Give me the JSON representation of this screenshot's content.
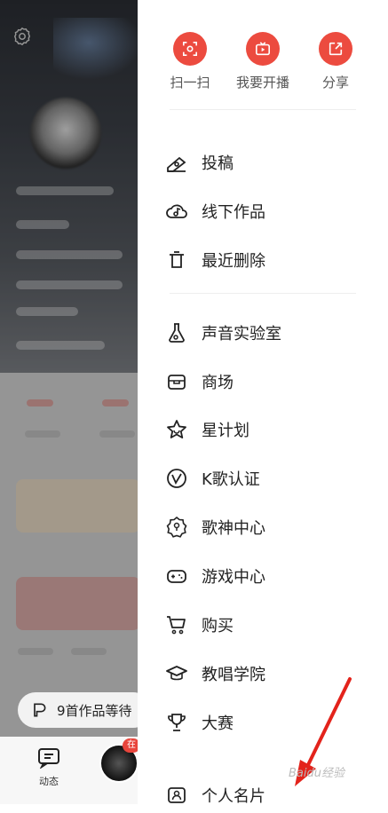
{
  "quick_actions": [
    {
      "label": "扫一扫",
      "icon": "scan-icon"
    },
    {
      "label": "我要开播",
      "icon": "live-tv-icon"
    },
    {
      "label": "分享",
      "icon": "share-icon"
    }
  ],
  "menu_groups": [
    [
      {
        "label": "投稿",
        "icon": "submit-icon"
      },
      {
        "label": "线下作品",
        "icon": "offline-works-icon"
      },
      {
        "label": "最近删除",
        "icon": "trash-icon"
      }
    ],
    [
      {
        "label": "声音实验室",
        "icon": "flask-icon"
      },
      {
        "label": "商场",
        "icon": "store-icon"
      },
      {
        "label": "星计划",
        "icon": "star-icon"
      },
      {
        "label": "K歌认证",
        "icon": "verified-icon"
      },
      {
        "label": "歌神中心",
        "icon": "badge-icon"
      },
      {
        "label": "游戏中心",
        "icon": "gamepad-icon"
      },
      {
        "label": "购买",
        "icon": "cart-icon"
      },
      {
        "label": "教唱学院",
        "icon": "graduation-cap-icon"
      },
      {
        "label": "大赛",
        "icon": "trophy-icon"
      }
    ],
    [
      {
        "label": "个人名片",
        "icon": "profile-card-icon"
      }
    ]
  ],
  "background": {
    "pill_text": "9首作品等待",
    "tab_dynamic_label": "动态",
    "live_badge": "在"
  },
  "colors": {
    "accent": "#ec4b3f",
    "arrow": "#e3231b"
  },
  "watermark": "Baidu经验"
}
